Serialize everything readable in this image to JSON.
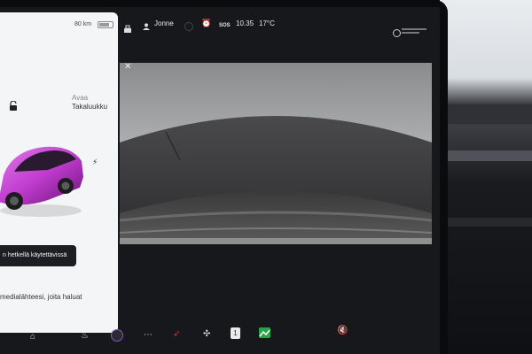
{
  "status_bar": {
    "range": "80 km",
    "user": "Jonne",
    "sos": "SOS",
    "time": "10.35",
    "temperature": "17°C"
  },
  "left_panel": {
    "trunk_action": "Avaa",
    "trunk_label": "Takaluukku",
    "notice": "n hetkellä käytettävissä",
    "media_text": "medialähteesi, joita haluat"
  },
  "dock": {
    "calc_label": "1"
  },
  "colors": {
    "car": "#c13ccf",
    "alarm": "#e5772e",
    "stocks": "#2aa24a"
  }
}
